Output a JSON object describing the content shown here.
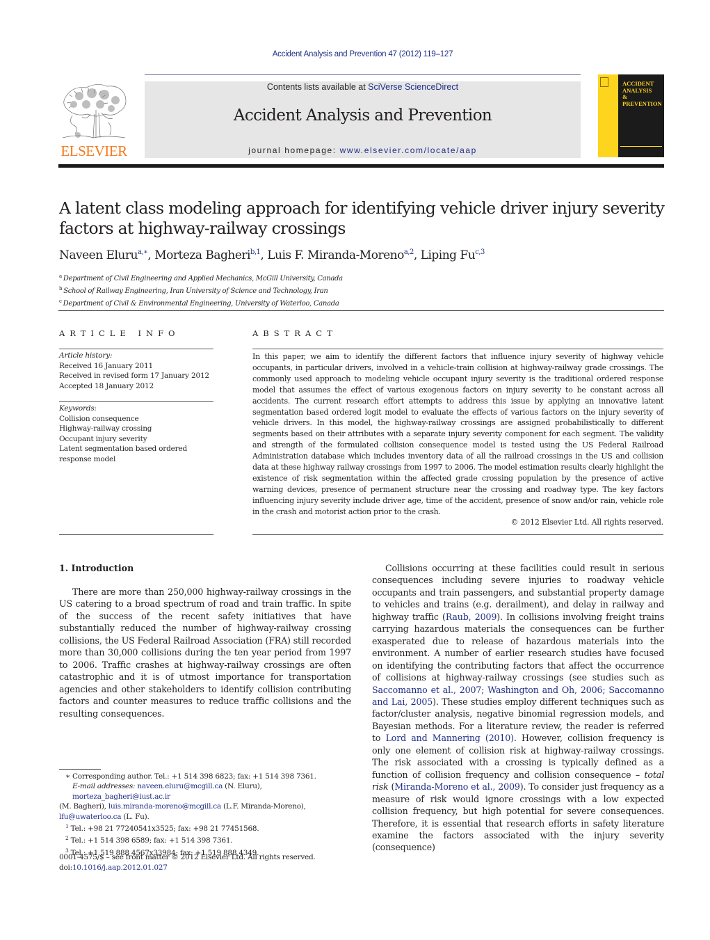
{
  "header": {
    "running_head": "Accident Analysis and Prevention 47 (2012) 119–127",
    "publisher_logo_text": "ELSEVIER",
    "contents_prefix": "Contents lists available at ",
    "contents_link": "SciVerse ScienceDirect",
    "journal_name": "Accident Analysis and Prevention",
    "homepage_prefix": "journal homepage: ",
    "homepage_link": "www.elsevier.com/locate/aap",
    "cover_title_lines": [
      "ACCIDENT",
      "ANALYSIS",
      "&",
      "PREVENTION"
    ],
    "colors": {
      "link": "#1f2e86",
      "elsevier_orange": "#f47b20",
      "cover_yellow": "#fdd51e",
      "masthead_gray": "#e6e6e7"
    }
  },
  "article": {
    "title": "A latent class modeling approach for identifying vehicle driver injury severity factors at highway-railway crossings",
    "authors": [
      {
        "name": "Naveen Eluru",
        "sup": "a,∗"
      },
      {
        "name": "Morteza Bagheri",
        "sup": "b,1"
      },
      {
        "name": "Luis F. Miranda-Moreno",
        "sup": "a,2"
      },
      {
        "name": "Liping Fu",
        "sup": "c,3"
      }
    ],
    "affiliations": [
      {
        "key": "a",
        "text": "Department of Civil Engineering and Applied Mechanics, McGill University, Canada"
      },
      {
        "key": "b",
        "text": "School of Railway Engineering, Iran University of Science and Technology, Iran"
      },
      {
        "key": "c",
        "text": "Department of Civil & Environmental Engineering, University of Waterloo, Canada"
      }
    ]
  },
  "article_info": {
    "heading": "ARTICLE INFO",
    "history_label": "Article history:",
    "history": [
      "Received 16 January 2011",
      "Received in revised form 17 January 2012",
      "Accepted 18 January 2012"
    ],
    "keywords_label": "Keywords:",
    "keywords": [
      "Collision consequence",
      "Highway-railway crossing",
      "Occupant injury severity",
      "Latent segmentation based ordered response model"
    ]
  },
  "abstract": {
    "heading": "ABSTRACT",
    "text": "In this paper, we aim to identify the different factors that influence injury severity of highway vehicle occupants, in particular drivers, involved in a vehicle-train collision at highway-railway grade crossings. The commonly used approach to modeling vehicle occupant injury severity is the traditional ordered response model that assumes the effect of various exogenous factors on injury severity to be constant across all accidents. The current research effort attempts to address this issue by applying an innovative latent segmentation based ordered logit model to evaluate the effects of various factors on the injury severity of vehicle drivers. In this model, the highway-railway crossings are assigned probabilistically to different segments based on their attributes with a separate injury severity component for each segment. The validity and strength of the formulated collision consequence model is tested using the US Federal Railroad Administration database which includes inventory data of all the railroad crossings in the US and collision data at these highway railway crossings from 1997 to 2006. The model estimation results clearly highlight the existence of risk segmentation within the affected grade crossing population by the presence of active warning devices, presence of permanent structure near the crossing and roadway type. The key factors influencing injury severity include driver age, time of the accident, presence of snow and/or rain, vehicle role in the crash and motorist action prior to the crash.",
    "copyright": "© 2012 Elsevier Ltd. All rights reserved."
  },
  "body": {
    "section_heading": "1.  Introduction",
    "left_para": "There are more than 250,000 highway-railway crossings in the US catering to a broad spectrum of road and train traffic. In spite of the success of the recent safety initiatives that have substantially reduced the number of highway-railway crossing collisions, the US Federal Railroad Association (FRA) still recorded more than 30,000 collisions during the ten year period from 1997 to 2006. Traffic crashes at highway-railway crossings are often catastrophic and it is of utmost importance for transportation agencies and other stakeholders to identify collision contributing factors and counter measures to reduce traffic collisions and the resulting consequences.",
    "right_para": {
      "t1": "Collisions occurring at these facilities could result in serious consequences including severe injuries to roadway vehicle occupants and train passengers, and substantial property damage to vehicles and trains (e.g. derailment), and delay in railway and highway traffic (",
      "c1": "Raub, 2009",
      "t2": "). In collisions involving freight trains carrying hazardous materials the consequences can be further exasperated due to release of hazardous materials into the environment. A number of earlier research studies have focused on identifying the contributing factors that affect the occurrence of collisions at highway-railway crossings (see studies such as ",
      "c2": "Saccomanno et al., 2007; Washington and Oh, 2006; Saccomanno and Lai, 2005",
      "t3": "). These studies employ different techniques such as factor/cluster analysis, negative binomial regression models, and Bayesian methods. For a literature review, the reader is referred to ",
      "c3": "Lord and Mannering (2010)",
      "t4": ". However, collision frequency is only one element of collision risk at highway-railway crossings. The risk associated with a crossing is typically defined as a function of collision frequency and collision consequence – ",
      "em": "total risk",
      "t5": " (",
      "c4": "Miranda-Moreno et al., 2009",
      "t6": "). To consider just frequency as a measure of risk would ignore crossings with a low expected collision frequency, but high potential for severe consequences. Therefore, it is essential that research efforts in safety literature examine the factors associated with the injury severity (consequence)"
    }
  },
  "footnotes": {
    "corresponding": "Corresponding author. Tel.: +1 514 398 6823; fax: +1 514 398 7361.",
    "star": "∗",
    "email_label": "E-mail addresses:",
    "emails": [
      {
        "addr": "naveen.eluru@mcgill.ca",
        "who": " (N. Eluru), "
      },
      {
        "addr": "morteza_bagheri@iust.ac.ir",
        "who": " (M. Bagheri), "
      },
      {
        "addr": "luis.miranda-moreno@mcgill.ca",
        "who": " (L.F. Miranda-Moreno), "
      },
      {
        "addr": "lfu@uwaterloo.ca",
        "who": " (L. Fu)."
      }
    ],
    "notes": [
      {
        "num": "1",
        "text": "Tel.: +98 21 77240541x3525; fax: +98 21 77451568."
      },
      {
        "num": "2",
        "text": "Tel.: +1 514 398 6589; fax: +1 514 398 7361."
      },
      {
        "num": "3",
        "text": "Tel.: +1 519 888 4567x33984; fax: +1 519 888 4349."
      }
    ],
    "front_matter": "0001-4575/$ – see front matter © 2012 Elsevier Ltd. All rights reserved.",
    "doi_prefix": "doi:",
    "doi": "10.1016/j.aap.2012.01.027"
  }
}
